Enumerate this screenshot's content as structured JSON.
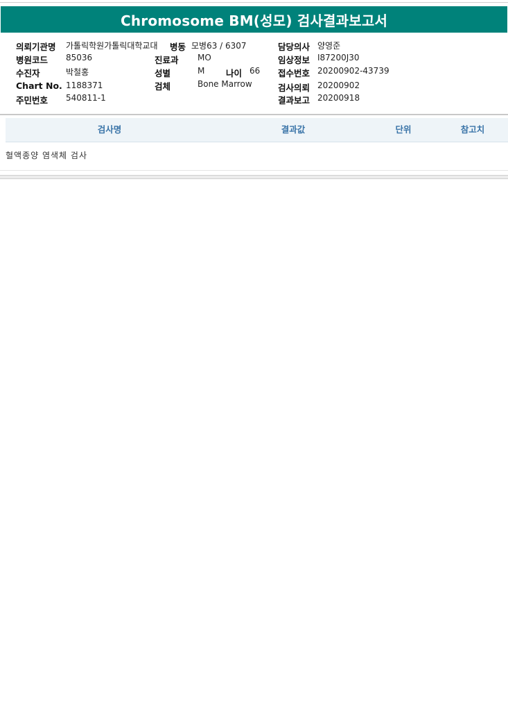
{
  "report": {
    "title": "Chromosome BM(성모) 검사결과보고서"
  },
  "info": {
    "institution_label": "의뢰기관명",
    "institution_value": "가톨릭학원가톨릭대학교대",
    "ward_label": "병동",
    "ward_value": "모병63 / 6307",
    "doctor_label": "담당의사",
    "doctor_value": "양영준",
    "hospital_code_label": "병원코드",
    "hospital_code_value": "85036",
    "department_label": "진료과",
    "department_value": "MO",
    "clinical_info_label": "임상정보",
    "clinical_info_value": "I87200J30",
    "patient_label": "수진자",
    "patient_value": "박철홍",
    "sex_label": "성별",
    "sex_value": "M",
    "age_label": "나이",
    "age_value": "66",
    "receipt_no_label": "접수번호",
    "receipt_no_value": "20200902-43739",
    "chart_no_label": "Chart No.",
    "chart_no_value": "1188371",
    "specimen_label": "검체",
    "specimen_value": "Bone Marrow",
    "request_date_label": "검사의뢰",
    "request_date_value": "20200902",
    "resident_no_label": "주민번호",
    "resident_no_value": "540811-1",
    "report_date_label": "결과보고",
    "report_date_value": "20200918"
  },
  "table": {
    "headers": {
      "test_name": "검사명",
      "result": "결과값",
      "unit": "단위",
      "reference": "참고치"
    },
    "rows": [
      {
        "test_name": "혈액종양 염색체 검사"
      }
    ]
  }
}
